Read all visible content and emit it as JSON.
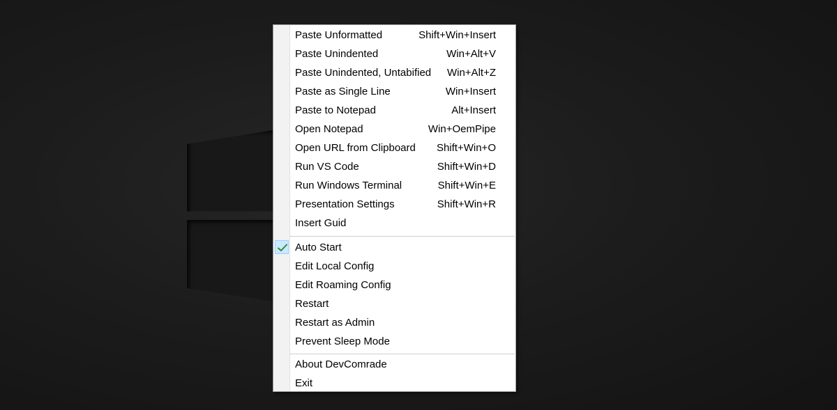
{
  "colors": {
    "menu_background": "#ffffff",
    "gutter_background": "#f2f2f2",
    "check_highlight": "#cce8ff",
    "check_mark": "#2e8b3a"
  },
  "menu": {
    "group1": [
      {
        "label": "Paste Unformatted",
        "shortcut": "Shift+Win+Insert"
      },
      {
        "label": "Paste Unindented",
        "shortcut": "Win+Alt+V"
      },
      {
        "label": "Paste Unindented, Untabified",
        "shortcut": "Win+Alt+Z"
      },
      {
        "label": "Paste as Single Line",
        "shortcut": "Win+Insert"
      },
      {
        "label": "Paste to Notepad",
        "shortcut": "Alt+Insert"
      },
      {
        "label": "Open Notepad",
        "shortcut": "Win+OemPipe"
      },
      {
        "label": "Open URL from Clipboard",
        "shortcut": "Shift+Win+O"
      },
      {
        "label": "Run VS Code",
        "shortcut": "Shift+Win+D"
      },
      {
        "label": "Run Windows Terminal",
        "shortcut": "Shift+Win+E"
      },
      {
        "label": "Presentation Settings",
        "shortcut": "Shift+Win+R"
      },
      {
        "label": "Insert Guid",
        "shortcut": ""
      }
    ],
    "group2": [
      {
        "label": "Auto Start",
        "checked": true,
        "icon": "checkmark-icon"
      },
      {
        "label": "Edit Local Config"
      },
      {
        "label": "Edit Roaming Config"
      },
      {
        "label": "Restart"
      },
      {
        "label": "Restart as Admin"
      },
      {
        "label": "Prevent Sleep Mode"
      }
    ],
    "group3": [
      {
        "label": "About DevComrade"
      },
      {
        "label": "Exit"
      }
    ]
  }
}
